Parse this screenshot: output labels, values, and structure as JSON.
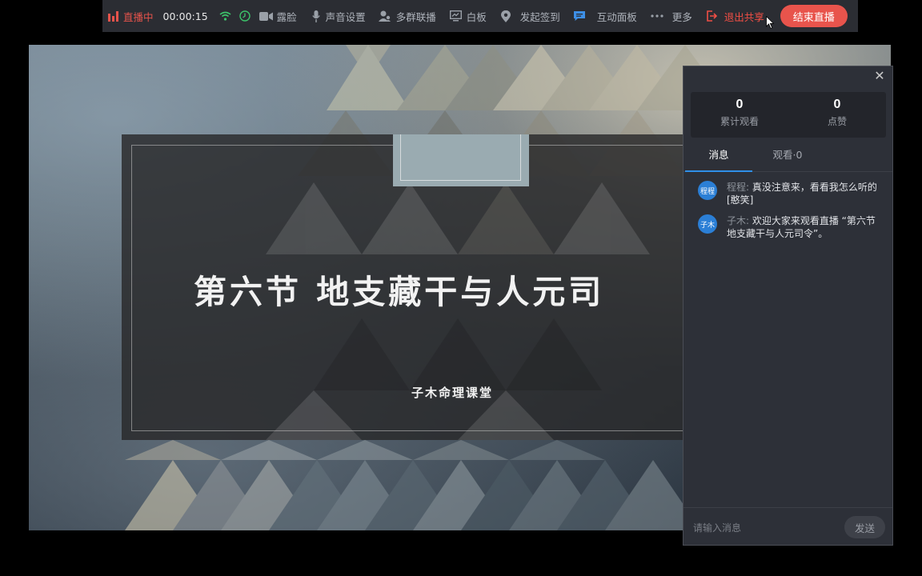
{
  "toolbar": {
    "live_label": "直播中",
    "timer": "00:00:15",
    "beauty_label": "露脸",
    "audio_label": "声音设置",
    "multi_label": "多群联播",
    "whiteboard_label": "白板",
    "checkin_label": "发起签到",
    "interact_label": "互动面板",
    "more_label": "更多",
    "exit_share_label": "退出共享",
    "end_label": "结束直播",
    "icons": [
      "live-bars-icon",
      "wifi-icon",
      "clock-icon",
      "camera-icon",
      "mic-icon",
      "users-icon",
      "monitor-icon",
      "location-pin-icon",
      "chat-bubble-icon",
      "more-dots-icon",
      "exit-icon"
    ]
  },
  "slide": {
    "title": "第六节  地支藏干与人元司",
    "subtitle": "子木命理课堂"
  },
  "chat": {
    "stats": [
      {
        "value": "0",
        "label": "累计观看"
      },
      {
        "value": "0",
        "label": "点赞"
      }
    ],
    "tabs": {
      "messages": "消息",
      "viewers": "观看·0"
    },
    "messages": [
      {
        "avatar": "程程",
        "name": "程程:",
        "text": " 真没注意来，看看我怎么听的[憨笑]"
      },
      {
        "avatar": "子木",
        "name": "子木:",
        "text": " 欢迎大家来观看直播 “第六节 地支藏干与人元司令”。"
      }
    ],
    "input_placeholder": "请输入消息",
    "send_label": "发送"
  },
  "colors": {
    "accent_red": "#e8544c",
    "tab_underline": "#2f8fe8",
    "avatar_blue": "#2b7fd6"
  }
}
